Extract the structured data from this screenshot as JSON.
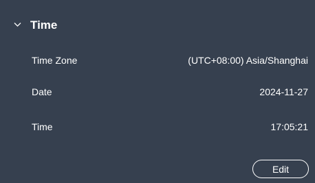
{
  "section": {
    "title": "Time",
    "chevron_icon": "chevron-down-icon",
    "expanded": true
  },
  "fields": {
    "time_zone": {
      "label": "Time Zone",
      "value": "(UTC+08:00) Asia/Shanghai"
    },
    "date": {
      "label": "Date",
      "value": "2024-11-27"
    },
    "time": {
      "label": "Time",
      "value": "17:05:21"
    }
  },
  "actions": {
    "edit_label": "Edit"
  },
  "colors": {
    "background": "#36404f",
    "text": "#ffffff"
  }
}
